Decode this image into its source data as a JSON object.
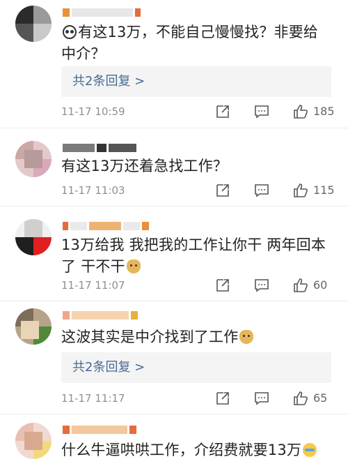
{
  "comments": [
    {
      "text": "有这13万，不能自己慢慢找？非要给中介？",
      "replies": "共2条回复 >",
      "time": "11-17 10:59",
      "likes": "185"
    },
    {
      "text": "有这13万还着急找工作？",
      "time": "11-17 11:03",
      "likes": "115"
    },
    {
      "text": "13万给我 我把我的工作让你干 两年回本了 干不干",
      "time": "11-17 11:07",
      "likes": "60"
    },
    {
      "text": "这波其实是中介找到了工作",
      "replies": "共2条回复 >",
      "time": "11-17 11:17",
      "likes": "65"
    },
    {
      "text": "什么牛逼哄哄工作，介绍费就要13万"
    }
  ],
  "icons": {
    "share": "share-icon",
    "comment": "comment-icon",
    "like": "like-icon"
  },
  "colors": {
    "reply_link": "#486a96",
    "meta": "#8f8f8f",
    "reply_bg": "#f4f4f4"
  }
}
